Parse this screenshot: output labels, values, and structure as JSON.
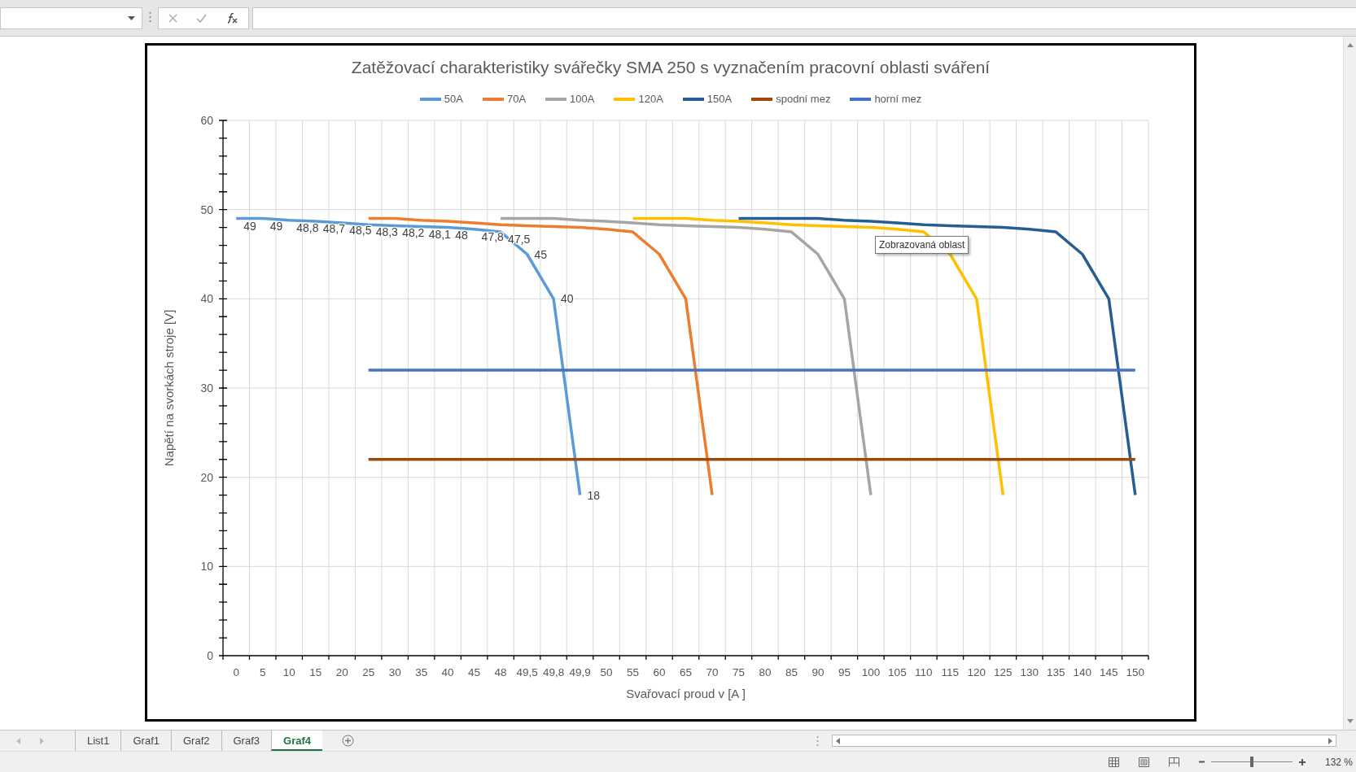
{
  "chart": {
    "chart_data": {
      "type": "line",
      "title": "Zatěžovací charakteristiky svářečky SMA 250 s vyznačením pracovní oblasti sváření",
      "xlabel": "Svařovací proud  v [A ]",
      "ylabel": "Napětí na svorkách stroje [V]",
      "categories": [
        "0",
        "5",
        "10",
        "15",
        "20",
        "25",
        "30",
        "35",
        "40",
        "45",
        "48",
        "49,5",
        "49,8",
        "49,9",
        "50",
        "55",
        "60",
        "65",
        "70",
        "75",
        "80",
        "85",
        "90",
        "95",
        "100",
        "105",
        "110",
        "115",
        "120",
        "125",
        "130",
        "135",
        "140",
        "145",
        "150"
      ],
      "series": [
        {
          "name": "50A",
          "color": "#5b9bd5",
          "value_labels": [
            "49",
            "49",
            "48,8",
            "48,7",
            "48,5",
            "48,3",
            "48,2",
            "48,1",
            "48",
            "47,8",
            "47,5",
            "45",
            "40",
            "18",
            null,
            null,
            null,
            null,
            null,
            null,
            null,
            null,
            null,
            null,
            null,
            null,
            null,
            null,
            null,
            null,
            null,
            null,
            null,
            null,
            null
          ],
          "values": [
            49,
            49,
            48.8,
            48.7,
            48.5,
            48.3,
            48.2,
            48.1,
            48,
            47.8,
            47.5,
            45,
            40,
            18,
            null,
            null,
            null,
            null,
            null,
            null,
            null,
            null,
            null,
            null,
            null,
            null,
            null,
            null,
            null,
            null,
            null,
            null,
            null,
            null,
            null
          ]
        },
        {
          "name": "70A",
          "color": "#ed7d31",
          "values": [
            null,
            null,
            null,
            null,
            null,
            49,
            49,
            48.8,
            48.7,
            48.5,
            48.3,
            48.2,
            48.1,
            48,
            47.8,
            47.5,
            45,
            40,
            18,
            null,
            null,
            null,
            null,
            null,
            null,
            null,
            null,
            null,
            null,
            null,
            null,
            null,
            null,
            null,
            null
          ]
        },
        {
          "name": "100A",
          "color": "#a5a5a5",
          "values": [
            null,
            null,
            null,
            null,
            null,
            null,
            null,
            null,
            null,
            null,
            49,
            49,
            49,
            48.8,
            48.7,
            48.5,
            48.3,
            48.2,
            48.1,
            48,
            47.8,
            47.5,
            45,
            40,
            18,
            null,
            null,
            null,
            null,
            null,
            null,
            null,
            null,
            null,
            null
          ]
        },
        {
          "name": "120A",
          "color": "#ffc000",
          "values": [
            null,
            null,
            null,
            null,
            null,
            null,
            null,
            null,
            null,
            null,
            null,
            null,
            null,
            null,
            null,
            49,
            49,
            49,
            48.8,
            48.7,
            48.5,
            48.3,
            48.2,
            48.1,
            48,
            47.8,
            47.5,
            45,
            40,
            18,
            null,
            null,
            null,
            null,
            null
          ]
        },
        {
          "name": "150A",
          "color": "#255e91",
          "values": [
            null,
            null,
            null,
            null,
            null,
            null,
            null,
            null,
            null,
            null,
            null,
            null,
            null,
            null,
            null,
            null,
            null,
            null,
            null,
            49,
            49,
            49,
            49,
            48.8,
            48.7,
            48.5,
            48.3,
            48.2,
            48.1,
            48,
            47.8,
            47.5,
            45,
            40,
            18
          ]
        },
        {
          "name": "spodní mez",
          "color": "#9e480e",
          "values": [
            null,
            null,
            null,
            null,
            null,
            22,
            22,
            22,
            22,
            22,
            22,
            22,
            22,
            22,
            22,
            22,
            22,
            22,
            22,
            22,
            22,
            22,
            22,
            22,
            22,
            22,
            22,
            22,
            22,
            22,
            22,
            22,
            22,
            22,
            22
          ]
        },
        {
          "name": "horní mez",
          "color": "#4472c4",
          "values": [
            null,
            null,
            null,
            null,
            null,
            32,
            32,
            32,
            32,
            32,
            32,
            32,
            32,
            32,
            32,
            32,
            32,
            32,
            32,
            32,
            32,
            32,
            32,
            32,
            32,
            32,
            32,
            32,
            32,
            32,
            32,
            32,
            32,
            32,
            32
          ]
        }
      ],
      "grid": true,
      "legend": true,
      "ylim": [
        0,
        60
      ],
      "yticks": [
        0,
        10,
        20,
        30,
        40,
        50,
        60
      ]
    },
    "tooltip": "Zobrazovaná oblast"
  },
  "sheet_tabs": [
    {
      "label": "List1",
      "selected": false
    },
    {
      "label": "Graf1",
      "selected": false
    },
    {
      "label": "Graf2",
      "selected": false
    },
    {
      "label": "Graf3",
      "selected": false
    },
    {
      "label": "Graf4",
      "selected": true
    }
  ],
  "status_bar": {
    "zoom": {
      "level": 0.5
    },
    "zoom_text": "132 %"
  }
}
